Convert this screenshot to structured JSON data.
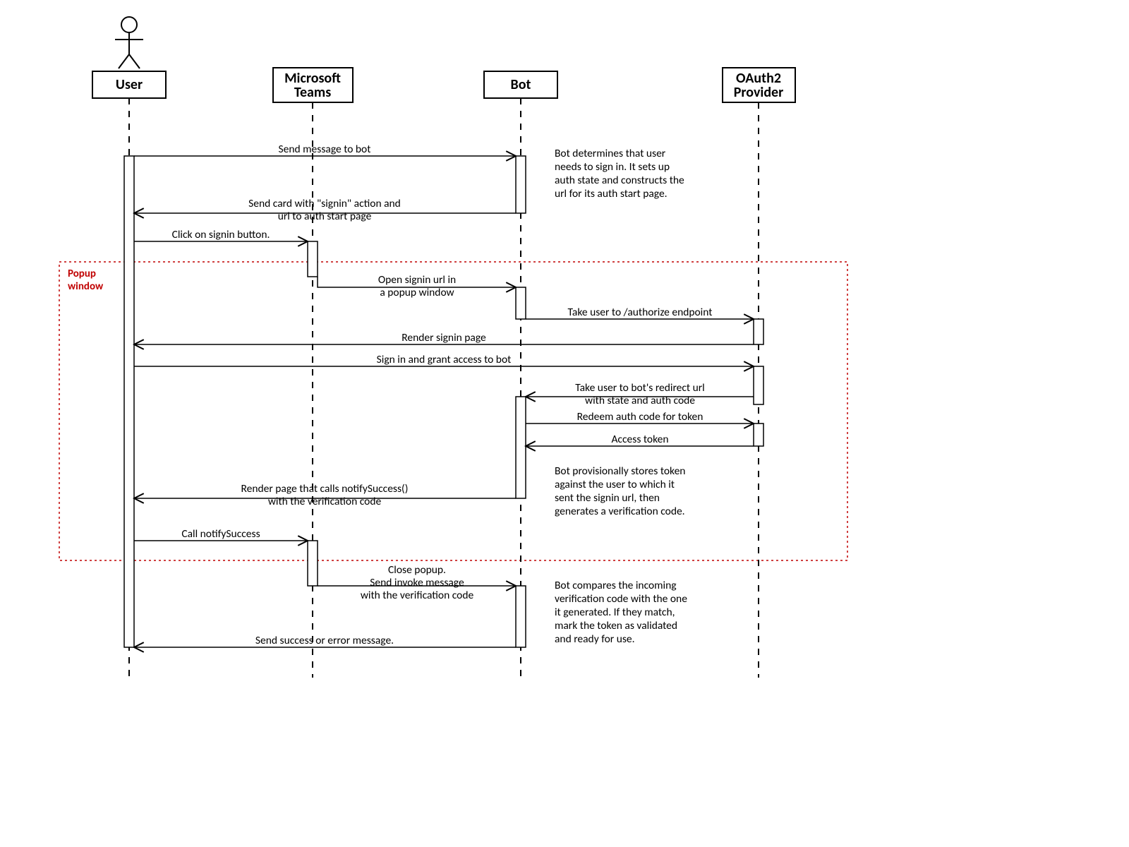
{
  "lanes": {
    "user": "User",
    "teams_l1": "Microsoft",
    "teams_l2": "Teams",
    "bot": "Bot",
    "oauth_l1": "OAuth2",
    "oauth_l2": "Provider"
  },
  "popup_label_l1": "Popup",
  "popup_label_l2": "window",
  "messages": {
    "m1": "Send message to bot",
    "m2_l1": "Send card with \"signin\" action and",
    "m2_l2": "url to auth start page",
    "m3": "Click on signin button.",
    "m4_l1": "Open signin url in",
    "m4_l2": "a popup window",
    "m5": "Take user to /authorize endpoint",
    "m6": "Render signin page",
    "m7": "Sign in and grant access to bot",
    "m8_l1": "Take user to bot's redirect url",
    "m8_l2": "with state and auth code",
    "m9": "Redeem auth code for token",
    "m10": "Access token",
    "m11_l1": "Render page that calls notifySuccess()",
    "m11_l2": "with the verification code",
    "m12": "Call notifySuccess",
    "m13_l1": "Close popup.",
    "m13_l2": "Send invoke message",
    "m13_l3": "with the verification code",
    "m14": "Send success or error message."
  },
  "notes": {
    "n1_l1": "Bot determines that user",
    "n1_l2": "needs to sign in. It sets up",
    "n1_l3": "auth state and constructs the",
    "n1_l4": "url for its auth start page.",
    "n2_l1": "Bot provisionally stores token",
    "n2_l2": "against the user to which it",
    "n2_l3": "sent the signin url, then",
    "n2_l4": "generates a verification code.",
    "n3_l1": "Bot compares the incoming",
    "n3_l2": "verification code with the one",
    "n3_l3": "it generated. If they match,",
    "n3_l4": "mark the token as validated",
    "n3_l5": "and ready for use."
  }
}
